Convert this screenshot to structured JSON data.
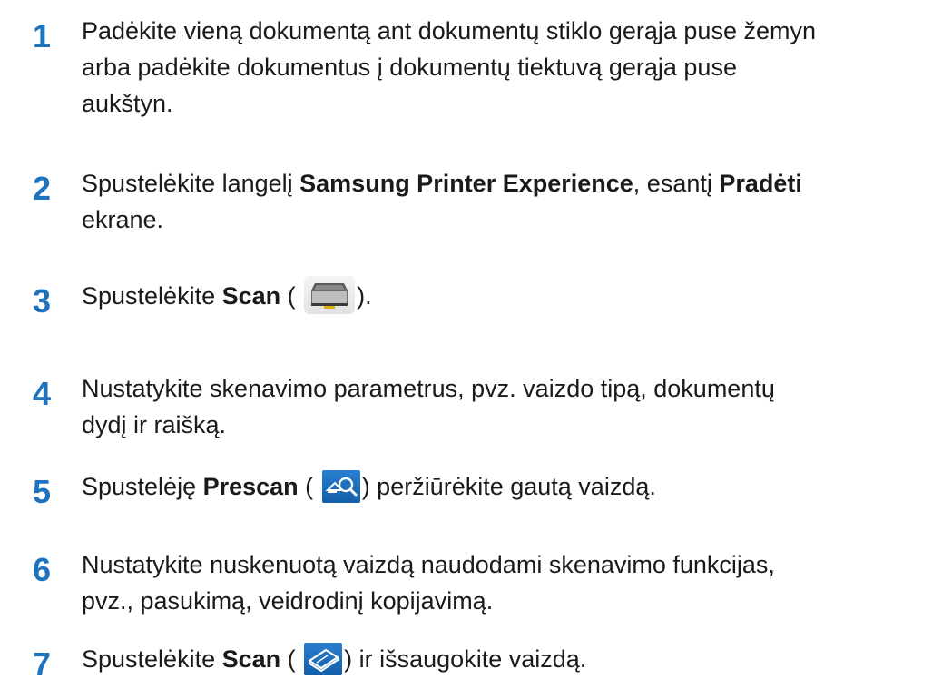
{
  "accent_color": "#1e73be",
  "steps": [
    {
      "number": "1",
      "lines": [
        "Padėkite vieną dokumentą ant dokumentų stiklo gerąja puse žemyn",
        "arba padėkite dokumentus į dokumentų tiektuvą gerąja puse",
        "aukštyn."
      ]
    },
    {
      "number": "2",
      "pre": "Spustelėkite langelį ",
      "bold1": "Samsung Printer Experience",
      "mid": ", esantį ",
      "bold2": "Pradėti",
      "line2": "ekrane."
    },
    {
      "number": "3",
      "pre": "Spustelėkite ",
      "bold": "Scan",
      "open": " (",
      "icon": "scanner-icon",
      "close": ")."
    },
    {
      "number": "4",
      "lines": [
        "Nustatykite skenavimo parametrus, pvz. vaizdo tipą, dokumentų",
        "dydį ir raišką."
      ]
    },
    {
      "number": "5",
      "pre": "Spustelėję ",
      "bold": "Prescan",
      "open": " (",
      "icon": "prescan-magnifier-icon",
      "close": ") peržiūrėkite gautą vaizdą."
    },
    {
      "number": "6",
      "lines": [
        "Nustatykite nuskenuotą vaizdą naudodami skenavimo funkcijas,",
        "pvz., pasukimą, veidrodinį kopijavimą."
      ]
    },
    {
      "number": "7",
      "pre": "Spustelėkite ",
      "bold": "Scan",
      "open": " (",
      "icon": "scan-scanner-icon",
      "close": ") ir išsaugokite vaizdą."
    }
  ]
}
